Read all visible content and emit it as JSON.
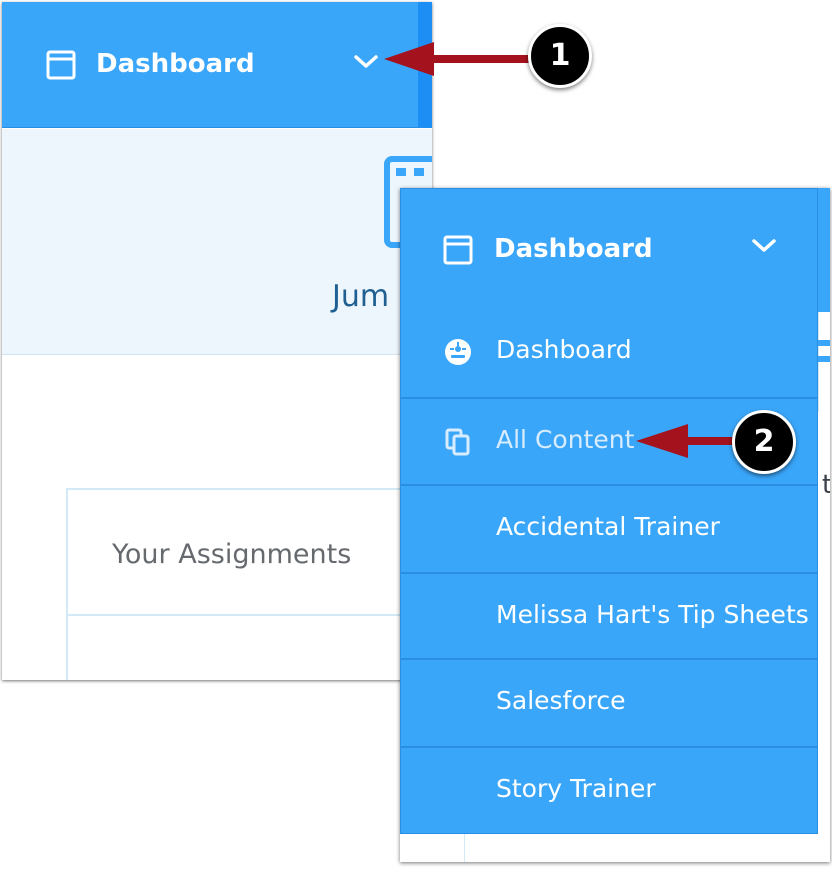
{
  "header": {
    "title": "Dashboard"
  },
  "hero": {
    "partial_text": "Jum"
  },
  "assignments": {
    "title": "Your Assignments"
  },
  "dropdown": {
    "title": "Dashboard",
    "items": [
      {
        "label": "Dashboard",
        "icon": "dashboard-gauge-icon"
      },
      {
        "label": "All Content",
        "icon": "copy-icon"
      },
      {
        "label": "Accidental Trainer"
      },
      {
        "label": "Melissa Hart's Tip Sheets"
      },
      {
        "label": "Salesforce"
      },
      {
        "label": "Story Trainer"
      }
    ],
    "right_stub": "t"
  },
  "callouts": [
    {
      "number": "1",
      "target": "dashboard-dropdown-toggle"
    },
    {
      "number": "2",
      "target": "all-content-item"
    }
  ],
  "colors": {
    "primary": "#3aa6f9",
    "primary_dark": "#1d8ef3",
    "band": "#eef6fd",
    "arrow": "#a3121d",
    "hero_text": "#1f5f91"
  }
}
